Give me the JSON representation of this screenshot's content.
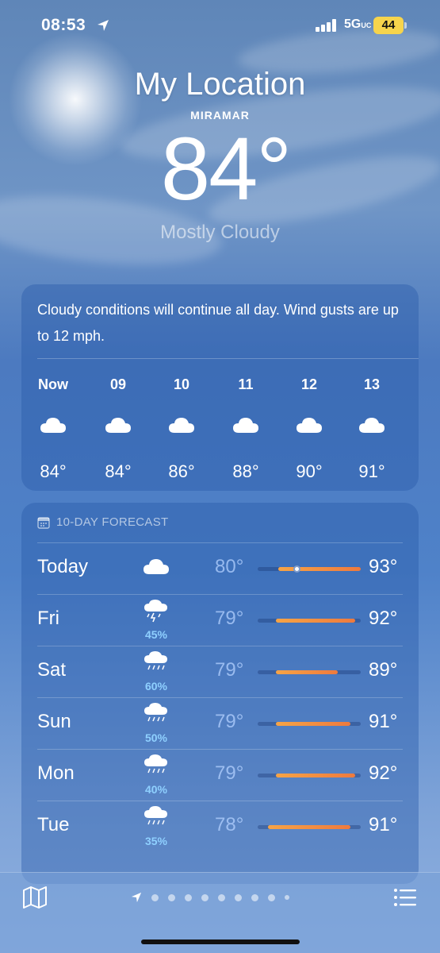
{
  "status_bar": {
    "time": "08:53",
    "network": "5G",
    "network_suffix": "UC",
    "battery": "44"
  },
  "header": {
    "title": "My Location",
    "city": "MIRAMAR",
    "temperature": "84°",
    "condition": "Mostly Cloudy"
  },
  "hourly": {
    "summary": "Cloudy conditions will continue all day. Wind gusts are up to 12 mph.",
    "items": [
      {
        "label": "Now",
        "icon": "cloud-icon",
        "temp": "84°"
      },
      {
        "label": "09",
        "icon": "cloud-icon",
        "temp": "84°"
      },
      {
        "label": "10",
        "icon": "cloud-icon",
        "temp": "86°"
      },
      {
        "label": "11",
        "icon": "cloud-icon",
        "temp": "88°"
      },
      {
        "label": "12",
        "icon": "cloud-icon",
        "temp": "90°"
      },
      {
        "label": "13",
        "icon": "cloud-icon",
        "temp": "91°"
      }
    ]
  },
  "forecast": {
    "heading": "10-DAY FORECAST",
    "days": [
      {
        "day": "Today",
        "icon": "cloud-icon",
        "precip": "",
        "low": "80°",
        "high": "93°",
        "range_start": 0.2,
        "range_end": 1.0,
        "current_pos": 0.38
      },
      {
        "day": "Fri",
        "icon": "thunderstorm-icon",
        "precip": "45%",
        "low": "79°",
        "high": "92°",
        "range_start": 0.18,
        "range_end": 0.95
      },
      {
        "day": "Sat",
        "icon": "rain-icon",
        "precip": "60%",
        "low": "79°",
        "high": "89°",
        "range_start": 0.18,
        "range_end": 0.78
      },
      {
        "day": "Sun",
        "icon": "rain-icon",
        "precip": "50%",
        "low": "79°",
        "high": "91°",
        "range_start": 0.18,
        "range_end": 0.9
      },
      {
        "day": "Mon",
        "icon": "rain-icon",
        "precip": "40%",
        "low": "79°",
        "high": "92°",
        "range_start": 0.18,
        "range_end": 0.95
      },
      {
        "day": "Tue",
        "icon": "rain-icon",
        "precip": "35%",
        "low": "78°",
        "high": "91°",
        "range_start": 0.1,
        "range_end": 0.9
      }
    ]
  },
  "colors": {
    "temp_bar_start": "#f6a446",
    "temp_bar_end": "#ee7a3e",
    "precip_text": "#8fd0ff"
  }
}
